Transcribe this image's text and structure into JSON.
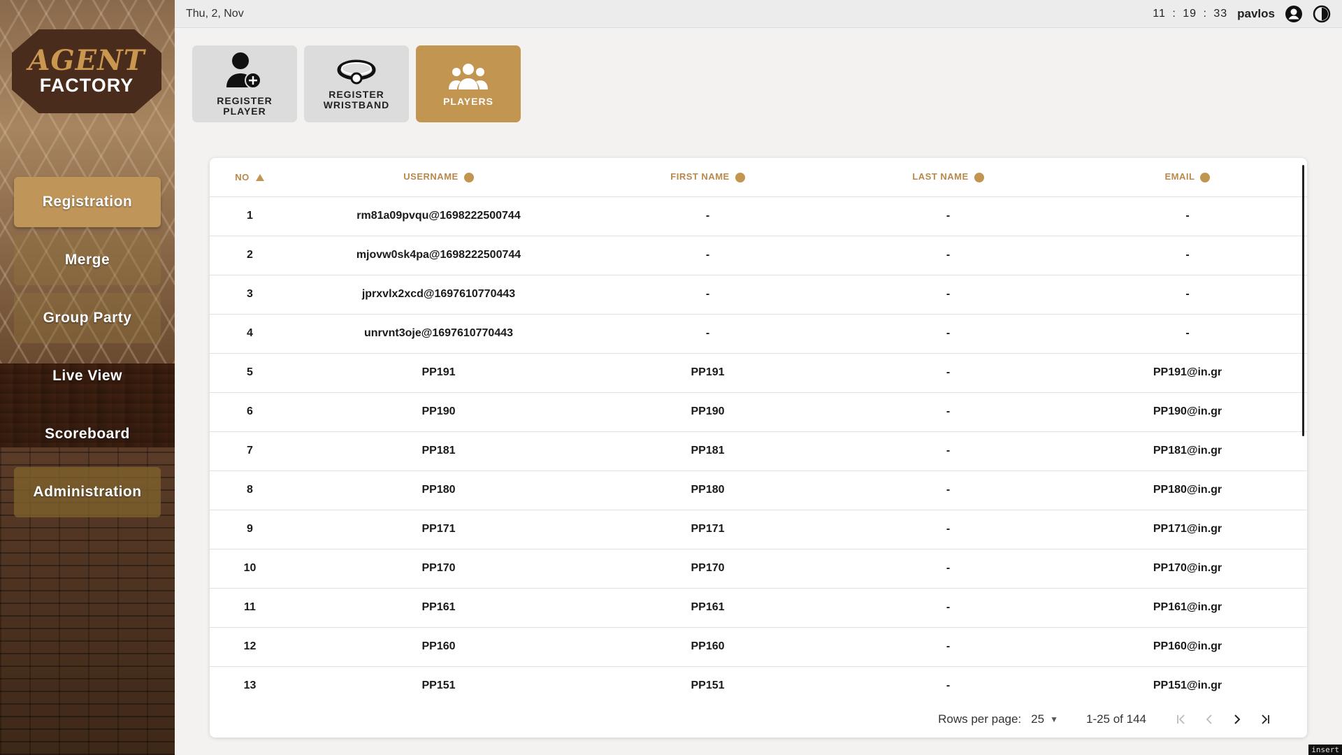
{
  "app": {
    "logo_top": "AGENT",
    "logo_bottom": "FACTORY"
  },
  "sidebar": {
    "items": [
      {
        "label": "Registration"
      },
      {
        "label": "Merge"
      },
      {
        "label": "Group Party"
      },
      {
        "label": "Live View"
      },
      {
        "label": "Scoreboard"
      },
      {
        "label": "Administration"
      }
    ]
  },
  "topbar": {
    "date": "Thu, 2, Nov",
    "clock": "11 : 19 : 33",
    "username": "pavlos",
    "icons": [
      "account-icon",
      "theme-toggle-icon"
    ]
  },
  "tiles": [
    {
      "line1": "REGISTER",
      "line2": "PLAYER",
      "icon": "add-user-icon"
    },
    {
      "line1": "REGISTER",
      "line2": "WRISTBAND",
      "icon": "wristband-icon"
    },
    {
      "line1": "PLAYERS",
      "line2": "",
      "icon": "group-icon"
    }
  ],
  "colors": {
    "accent": "#c29550",
    "header_text": "#b8894a",
    "tile_inactive": "#dcdcdc"
  },
  "table": {
    "headers": [
      "NO",
      "USERNAME",
      "FIRST NAME",
      "LAST NAME",
      "EMAIL"
    ],
    "rows": [
      [
        "1",
        "rm81a09pvqu@1698222500744",
        "-",
        "-",
        "-"
      ],
      [
        "2",
        "mjovw0sk4pa@1698222500744",
        "-",
        "-",
        "-"
      ],
      [
        "3",
        "jprxvlx2xcd@1697610770443",
        "-",
        "-",
        "-"
      ],
      [
        "4",
        "unrvnt3oje@1697610770443",
        "-",
        "-",
        "-"
      ],
      [
        "5",
        "PP191",
        "PP191",
        "-",
        "PP191@in.gr"
      ],
      [
        "6",
        "PP190",
        "PP190",
        "-",
        "PP190@in.gr"
      ],
      [
        "7",
        "PP181",
        "PP181",
        "-",
        "PP181@in.gr"
      ],
      [
        "8",
        "PP180",
        "PP180",
        "-",
        "PP180@in.gr"
      ],
      [
        "9",
        "PP171",
        "PP171",
        "-",
        "PP171@in.gr"
      ],
      [
        "10",
        "PP170",
        "PP170",
        "-",
        "PP170@in.gr"
      ],
      [
        "11",
        "PP161",
        "PP161",
        "-",
        "PP161@in.gr"
      ],
      [
        "12",
        "PP160",
        "PP160",
        "-",
        "PP160@in.gr"
      ],
      [
        "13",
        "PP151",
        "PP151",
        "-",
        "PP151@in.gr"
      ]
    ]
  },
  "pagination": {
    "rows_per_page_label": "Rows per page:",
    "rows_per_page_value": "25",
    "range": "1-25 of 144"
  },
  "status_tag": "insert"
}
